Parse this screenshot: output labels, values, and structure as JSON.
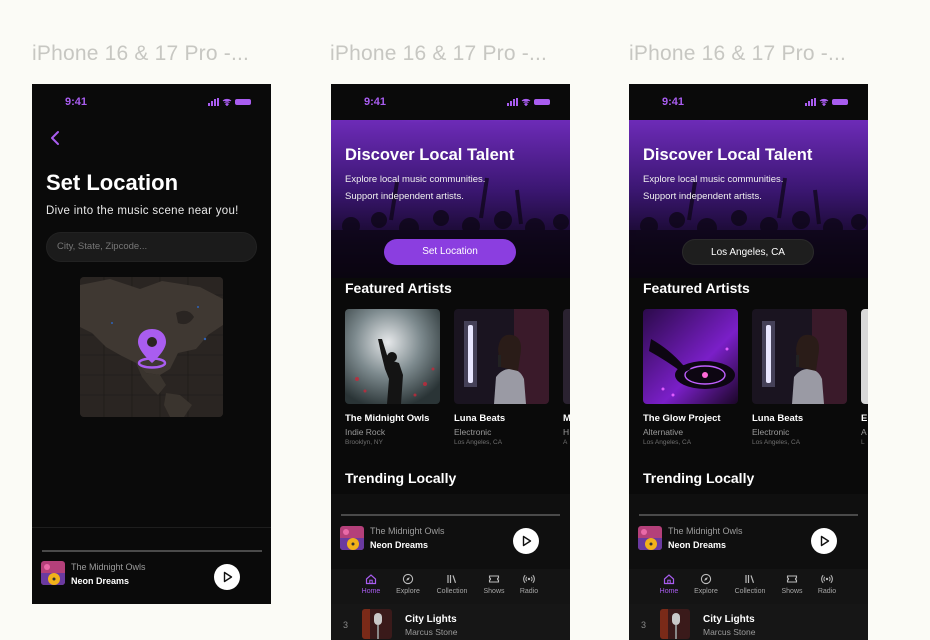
{
  "frames": [
    {
      "label": "iPhone 16 & 17 Pro -...",
      "time": "9:41",
      "title": "Set Location",
      "subtitle": "Dive into the music scene near you!",
      "search_placeholder": "City, State, Zipcode...",
      "player": {
        "artist": "The Midnight Owls",
        "song": "Neon Dreams"
      }
    },
    {
      "label": "iPhone 16 & 17 Pro -...",
      "time": "9:41",
      "hero": {
        "title": "Discover Local Talent",
        "line1": "Explore local music communities.",
        "line2": "Support independent artists.",
        "button": "Set Location"
      },
      "featured_title": "Featured Artists",
      "artists": [
        {
          "name": "The Midnight Owls",
          "genre": "Indie Rock",
          "location": "Brooklyn, NY"
        },
        {
          "name": "Luna Beats",
          "genre": "Electronic",
          "location": "Los Angeles, CA"
        },
        {
          "name": "M",
          "genre": "H",
          "location": "A"
        }
      ],
      "trending_title": "Trending Locally",
      "player": {
        "artist": "The Midnight Owls",
        "song": "Neon Dreams"
      },
      "trend_item": {
        "rank": "3",
        "song": "City Lights",
        "artist": "Marcus Stone"
      }
    },
    {
      "label": "iPhone 16 & 17 Pro -...",
      "time": "9:41",
      "hero": {
        "title": "Discover Local Talent",
        "line1": "Explore local music communities.",
        "line2": "Support independent artists.",
        "button": "Los Angeles, CA"
      },
      "featured_title": "Featured Artists",
      "artists": [
        {
          "name": "The Glow Project",
          "genre": "Alternative",
          "location": "Los Angeles, CA"
        },
        {
          "name": "Luna Beats",
          "genre": "Electronic",
          "location": "Los Angeles, CA"
        },
        {
          "name": "E",
          "genre": "A",
          "location": "L"
        }
      ],
      "trending_title": "Trending Locally",
      "player": {
        "artist": "The Midnight Owls",
        "song": "Neon Dreams"
      },
      "trend_item": {
        "rank": "3",
        "song": "City Lights",
        "artist": "Marcus Stone"
      }
    }
  ],
  "nav": [
    "Home",
    "Explore",
    "Collection",
    "Shows",
    "Radio"
  ],
  "icons": {
    "back": "chevron-left-icon",
    "pin": "location-pin-icon",
    "play": "play-icon",
    "home": "home-icon",
    "explore": "compass-icon",
    "collection": "library-icon",
    "shows": "ticket-icon",
    "radio": "broadcast-icon"
  },
  "colors": {
    "accent": "#8b3ee0",
    "accent_light": "#a95df0",
    "background": "#0a0a0a",
    "canvas": "#fbfbf6",
    "pill_dark": "#1e1e1e"
  }
}
